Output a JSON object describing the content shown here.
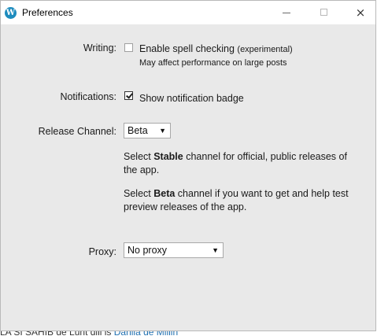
{
  "window": {
    "title": "Preferences",
    "icon": "wordpress-logo-icon",
    "controls": {
      "minimize": "minimize-icon",
      "maximize": "maximize-icon",
      "close": "×"
    }
  },
  "writing": {
    "label": "Writing:",
    "spell_check_label": "Enable spell checking",
    "spell_check_note": "(experimental)",
    "spell_check_hint": "May affect performance on large posts",
    "spell_check_checked": false
  },
  "notifications": {
    "label": "Notifications:",
    "badge_label": "Show notification badge",
    "badge_checked": true
  },
  "release_channel": {
    "label": "Release Channel:",
    "selected": "Beta",
    "stable_pre": "Select ",
    "stable_word": "Stable",
    "stable_post": " channel for official, public releases of the app.",
    "beta_pre": "Select ",
    "beta_word": "Beta",
    "beta_post": " channel if you want to get and help test preview releases of the app."
  },
  "proxy": {
    "label": "Proxy:",
    "selected": "No proxy"
  },
  "background": {
    "text_plain": "LA SI SAHIB de Lunt dill is ",
    "text_link": "Danila de Millin"
  },
  "colors": {
    "window_bg": "#e9e9e9",
    "titlebar_bg": "#ffffff",
    "wp_blue": "#1e8cbe"
  }
}
